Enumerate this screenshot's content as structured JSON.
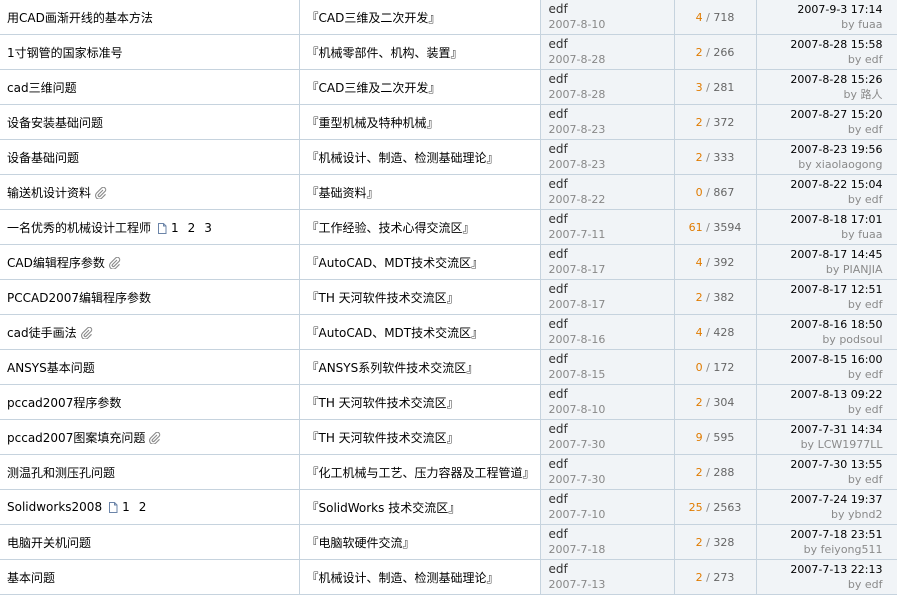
{
  "threads": [
    {
      "subject": "用CAD画渐开线的基本方法",
      "forum": "『CAD三维及二次开发』",
      "author": "edf",
      "date": "2007-8-10",
      "replies": "4",
      "views": "718",
      "last_time": "2007-9-3 17:14",
      "last_by_prefix": "by",
      "last_user": "fuaa",
      "attachment": false,
      "pages": []
    },
    {
      "subject": "1寸钢管的国家标准号",
      "forum": "『机械零部件、机构、装置』",
      "author": "edf",
      "date": "2007-8-28",
      "replies": "2",
      "views": "266",
      "last_time": "2007-8-28 15:58",
      "last_by_prefix": "by",
      "last_user": "edf",
      "attachment": false,
      "pages": []
    },
    {
      "subject": "cad三维问题",
      "forum": "『CAD三维及二次开发』",
      "author": "edf",
      "date": "2007-8-28",
      "replies": "3",
      "views": "281",
      "last_time": "2007-8-28 15:26",
      "last_by_prefix": "by",
      "last_user": "路人",
      "attachment": false,
      "pages": []
    },
    {
      "subject": "设备安装基础问题",
      "forum": "『重型机械及特种机械』",
      "author": "edf",
      "date": "2007-8-23",
      "replies": "2",
      "views": "372",
      "last_time": "2007-8-27 15:20",
      "last_by_prefix": "by",
      "last_user": "edf",
      "attachment": false,
      "pages": []
    },
    {
      "subject": "设备基础问题",
      "forum": "『机械设计、制造、检测基础理论』",
      "author": "edf",
      "date": "2007-8-23",
      "replies": "2",
      "views": "333",
      "last_time": "2007-8-23 19:56",
      "last_by_prefix": "by",
      "last_user": "xiaolaogong",
      "attachment": false,
      "pages": []
    },
    {
      "subject": "输送机设计资料",
      "forum": "『基础资料』",
      "author": "edf",
      "date": "2007-8-22",
      "replies": "0",
      "views": "867",
      "last_time": "2007-8-22 15:04",
      "last_by_prefix": "by",
      "last_user": "edf",
      "attachment": true,
      "pages": []
    },
    {
      "subject": "一名优秀的机械设计工程师",
      "forum": "『工作经验、技术心得交流区』",
      "author": "edf",
      "date": "2007-7-11",
      "replies": "61",
      "views": "3594",
      "last_time": "2007-8-18 17:01",
      "last_by_prefix": "by",
      "last_user": "fuaa",
      "attachment": false,
      "pages": [
        "1",
        "2",
        "3"
      ]
    },
    {
      "subject": "CAD编辑程序参数",
      "forum": "『AutoCAD、MDT技术交流区』",
      "author": "edf",
      "date": "2007-8-17",
      "replies": "4",
      "views": "392",
      "last_time": "2007-8-17 14:45",
      "last_by_prefix": "by",
      "last_user": "PIANJIA",
      "attachment": true,
      "pages": []
    },
    {
      "subject": "PCCAD2007编辑程序参数",
      "forum": "『TH 天河软件技术交流区』",
      "author": "edf",
      "date": "2007-8-17",
      "replies": "2",
      "views": "382",
      "last_time": "2007-8-17 12:51",
      "last_by_prefix": "by",
      "last_user": "edf",
      "attachment": false,
      "pages": []
    },
    {
      "subject": "cad徒手画法",
      "forum": "『AutoCAD、MDT技术交流区』",
      "author": "edf",
      "date": "2007-8-16",
      "replies": "4",
      "views": "428",
      "last_time": "2007-8-16 18:50",
      "last_by_prefix": "by",
      "last_user": "podsoul",
      "attachment": true,
      "pages": []
    },
    {
      "subject": "ANSYS基本问题",
      "forum": "『ANSYS系列软件技术交流区』",
      "author": "edf",
      "date": "2007-8-15",
      "replies": "0",
      "views": "172",
      "last_time": "2007-8-15 16:00",
      "last_by_prefix": "by",
      "last_user": "edf",
      "attachment": false,
      "pages": []
    },
    {
      "subject": "pccad2007程序参数",
      "forum": "『TH 天河软件技术交流区』",
      "author": "edf",
      "date": "2007-8-10",
      "replies": "2",
      "views": "304",
      "last_time": "2007-8-13 09:22",
      "last_by_prefix": "by",
      "last_user": "edf",
      "attachment": false,
      "pages": []
    },
    {
      "subject": "pccad2007图案填充问题",
      "forum": "『TH 天河软件技术交流区』",
      "author": "edf",
      "date": "2007-7-30",
      "replies": "9",
      "views": "595",
      "last_time": "2007-7-31 14:34",
      "last_by_prefix": "by",
      "last_user": "LCW1977LL",
      "attachment": true,
      "pages": []
    },
    {
      "subject": "测温孔和测压孔问题",
      "forum": "『化工机械与工艺、压力容器及工程管道』",
      "author": "edf",
      "date": "2007-7-30",
      "replies": "2",
      "views": "288",
      "last_time": "2007-7-30 13:55",
      "last_by_prefix": "by",
      "last_user": "edf",
      "attachment": false,
      "pages": []
    },
    {
      "subject": "Solidworks2008",
      "forum": "『SolidWorks 技术交流区』",
      "author": "edf",
      "date": "2007-7-10",
      "replies": "25",
      "views": "2563",
      "last_time": "2007-7-24 19:37",
      "last_by_prefix": "by",
      "last_user": "ybnd2",
      "attachment": false,
      "pages": [
        "1",
        "2"
      ]
    },
    {
      "subject": "电脑开关机问题",
      "forum": "『电脑软硬件交流』",
      "author": "edf",
      "date": "2007-7-18",
      "replies": "2",
      "views": "328",
      "last_time": "2007-7-18 23:51",
      "last_by_prefix": "by",
      "last_user": "feiyong511",
      "attachment": false,
      "pages": []
    },
    {
      "subject": "基本问题",
      "forum": "『机械设计、制造、检测基础理论』",
      "author": "edf",
      "date": "2007-7-13",
      "replies": "2",
      "views": "273",
      "last_time": "2007-7-13 22:13",
      "last_by_prefix": "by",
      "last_user": "edf",
      "attachment": false,
      "pages": []
    }
  ]
}
